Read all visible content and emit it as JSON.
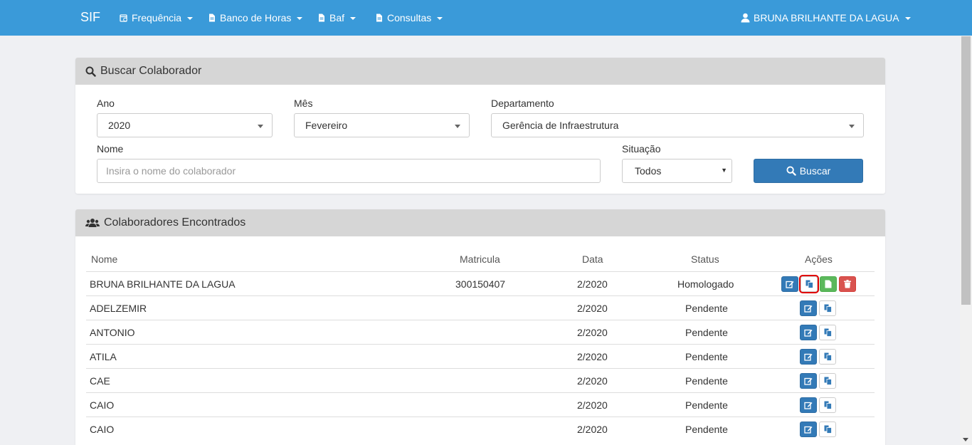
{
  "navbar": {
    "brand": "SIF",
    "items": [
      {
        "label": "Frequência",
        "icon": "clock-calendar-icon"
      },
      {
        "label": "Banco de Horas",
        "icon": "document-icon"
      },
      {
        "label": "Baf",
        "icon": "document-icon"
      },
      {
        "label": "Consultas",
        "icon": "document-icon"
      }
    ],
    "user": {
      "label": "BRUNA BRILHANTE DA LAGUA",
      "icon": "user-icon"
    }
  },
  "search_panel": {
    "title": "Buscar Colaborador",
    "ano": {
      "label": "Ano",
      "value": "2020"
    },
    "mes": {
      "label": "Mês",
      "value": "Fevereiro"
    },
    "departamento": {
      "label": "Departamento",
      "value": "Gerência de Infraestrutura"
    },
    "nome": {
      "label": "Nome",
      "placeholder": "Insira o nome do colaborador"
    },
    "situacao": {
      "label": "Situação",
      "value": "Todos"
    },
    "button": "Buscar"
  },
  "results_panel": {
    "title": "Colaboradores Encontrados",
    "columns": [
      "Nome",
      "Matricula",
      "Data",
      "Status",
      "Ações"
    ],
    "rows": [
      {
        "nome": "BRUNA BRILHANTE DA LAGUA",
        "matricula": "300150407",
        "data": "2/2020",
        "status": "Homologado"
      },
      {
        "nome": "ADELZEMIR",
        "matricula": "",
        "data": "2/2020",
        "status": "Pendente"
      },
      {
        "nome": "ANTONIO",
        "matricula": "",
        "data": "2/2020",
        "status": "Pendente"
      },
      {
        "nome": "ATILA",
        "matricula": "",
        "data": "2/2020",
        "status": "Pendente"
      },
      {
        "nome": "CAE",
        "matricula": "",
        "data": "2/2020",
        "status": "Pendente"
      },
      {
        "nome": "CAIO",
        "matricula": "",
        "data": "2/2020",
        "status": "Pendente"
      },
      {
        "nome": "CAIO",
        "matricula": "",
        "data": "2/2020",
        "status": "Pendente"
      }
    ]
  },
  "colors": {
    "navbar": "#3a9ad9",
    "primary": "#337ab7",
    "success": "#5cb85c",
    "danger": "#d9534f",
    "highlight": "#e00000"
  }
}
